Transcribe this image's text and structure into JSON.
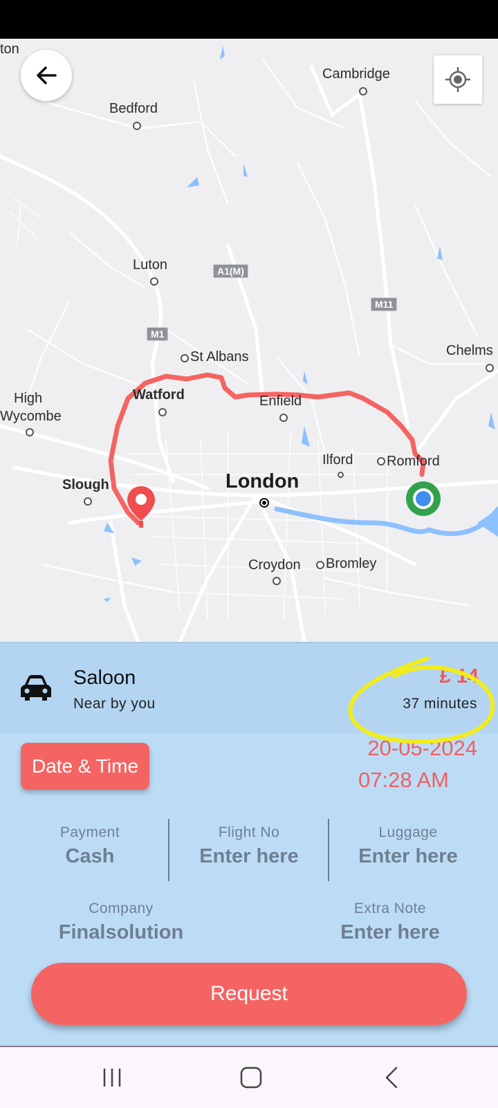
{
  "map": {
    "towns": {
      "ton": "ton",
      "cambridge": "Cambridge",
      "bedford": "Bedford",
      "luton": "Luton",
      "st_albans": "St Albans",
      "chelms": "Chelms",
      "high": "High",
      "wycombe": "Wycombe",
      "watford": "Watford",
      "enfield": "Enfield",
      "ilford": "Ilford",
      "romford": "Romford",
      "slough": "Slough",
      "london": "London",
      "croydon": "Croydon",
      "bromley": "Bromley"
    },
    "road_shields": {
      "a1m": "A1(M)",
      "m11": "M11",
      "m1": "M1"
    },
    "route_color": "#f46462",
    "origin_color": "#3f8ef0",
    "destination_color": "#f04e4e"
  },
  "ride": {
    "name": "Saloon",
    "subtitle": "Near by you",
    "price": "£ 14",
    "duration": "37 minutes"
  },
  "schedule": {
    "button_label": "Date & Time",
    "date": "20-05-2024",
    "time": "07:28 AM"
  },
  "fields": {
    "payment": {
      "label": "Payment",
      "value": "Cash"
    },
    "flight": {
      "label": "Flight No",
      "value": "Enter here"
    },
    "luggage": {
      "label": "Luggage",
      "value": "Enter here"
    },
    "company": {
      "label": "Company",
      "value": "Finalsolution"
    },
    "note": {
      "label": "Extra Note",
      "value": "Enter here"
    }
  },
  "request_label": "Request",
  "colors": {
    "accent": "#f46462",
    "panel_bg": "#bcdcf6",
    "highlight": "#f2ec1a"
  },
  "icons": {
    "back": "arrow-left-icon",
    "locate": "crosshair-icon",
    "car": "car-icon",
    "nav_recents": "recents-icon",
    "nav_home": "home-icon",
    "nav_back": "chevron-left-icon"
  }
}
